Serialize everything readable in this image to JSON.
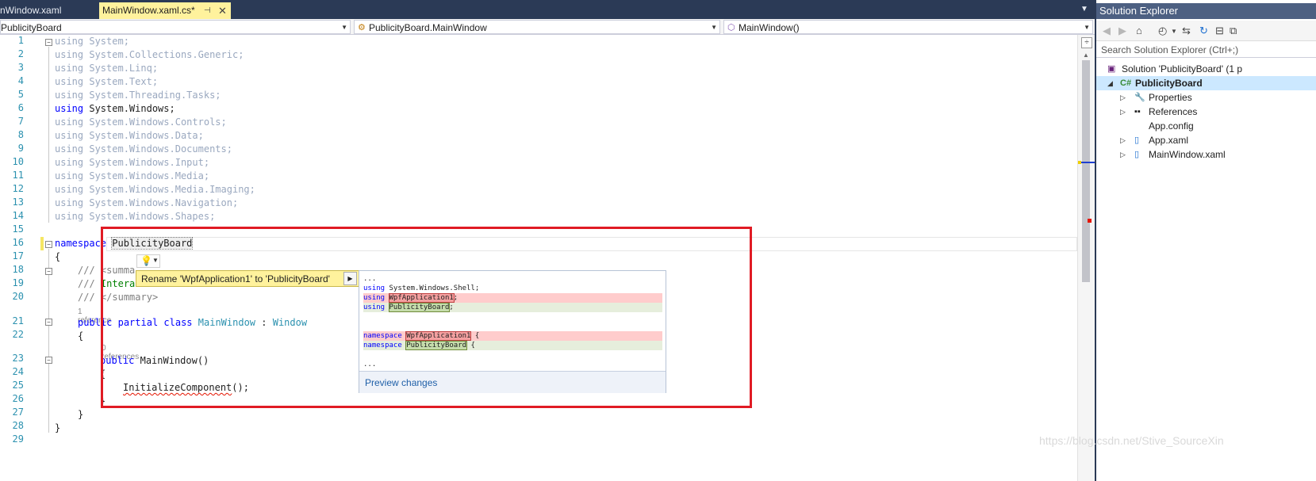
{
  "tabs": [
    {
      "label": "nWindow.xaml",
      "active": false
    },
    {
      "label": "MainWindow.xaml.cs*",
      "active": true
    }
  ],
  "navbar": {
    "project": "PublicityBoard",
    "type": "PublicityBoard.MainWindow",
    "member": "MainWindow()"
  },
  "line_numbers": [
    "1",
    "2",
    "3",
    "4",
    "5",
    "6",
    "7",
    "8",
    "9",
    "10",
    "11",
    "12",
    "13",
    "14",
    "15",
    "16",
    "17",
    "18",
    "19",
    "20",
    "21",
    "22",
    "23",
    "24",
    "25",
    "26",
    "27",
    "28",
    "29"
  ],
  "code": {
    "using_kw": "using",
    "usings": [
      "System;",
      "System.Collections.Generic;",
      "System.Linq;",
      "System.Text;",
      "System.Threading.Tasks;",
      "System.Windows;",
      "System.Windows.Controls;",
      "System.Windows.Data;",
      "System.Windows.Documents;",
      "System.Windows.Input;",
      "System.Windows.Media;",
      "System.Windows.Media.Imaging;",
      "System.Windows.Navigation;",
      "System.Windows.Shapes;"
    ],
    "namespace_kw": "namespace",
    "namespace_name": "PublicityBoard",
    "brace_open": "{",
    "brace_close": "}",
    "doc_prefix": "///",
    "doc_18_tag": "<summa",
    "doc_19_text": "Intera",
    "doc_20_tag": "</summary>",
    "ref_lens_1": "1 reference",
    "public_kw": "public",
    "partial_kw": "partial",
    "class_kw": "class",
    "class_name": "MainWindow",
    "colon": ":",
    "base_type": "Window",
    "ref_lens_2": "0 references",
    "ctor": "MainWindow()",
    "call": "InitializeComponent",
    "call_tail": "();"
  },
  "quick_action": {
    "label": "Rename 'WpfApplication1' to 'PublicityBoard'"
  },
  "preview": {
    "ellipsis": "...",
    "using_kw": "using",
    "shell_ns": "System.Windows.Shell;",
    "old_ns": "WpfApplication1",
    "new_ns": "PublicityBoard",
    "semicolon": ";",
    "namespace_kw": "namespace",
    "brace": " {",
    "preview_link": "Preview changes"
  },
  "solution_explorer": {
    "title": "Solution Explorer",
    "search_placeholder": "Search Solution Explorer (Ctrl+;)",
    "solution": "Solution 'PublicityBoard' (1 p",
    "project": "PublicityBoard",
    "items": [
      "Properties",
      "References",
      "App.config",
      "App.xaml",
      "MainWindow.xaml"
    ]
  },
  "watermark": "https://blog.csdn.net/Stive_SourceXin",
  "colors": {
    "keyword": "#0000ff",
    "type": "#2b91af",
    "comment": "#008000",
    "active_tab": "#fff29d",
    "callout_border": "#e01b24"
  }
}
